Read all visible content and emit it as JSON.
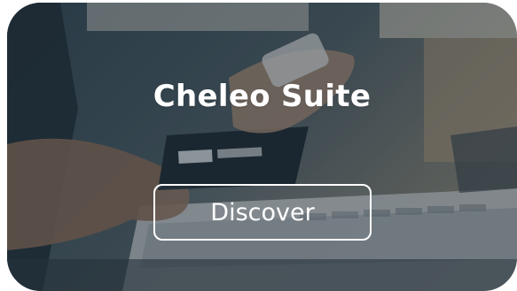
{
  "card": {
    "title": "Cheleo Suite",
    "button_label": "Discover"
  },
  "colors": {
    "overlay": "#1e2a32",
    "text": "#ffffff",
    "button_border": "#ffffff"
  },
  "background": {
    "image_subject": "hands holding a credit card and phone over a laptop keyboard"
  }
}
